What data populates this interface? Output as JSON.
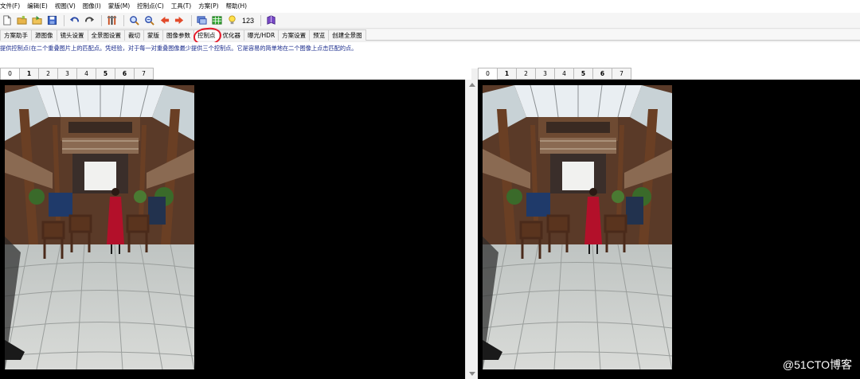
{
  "menu": [
    "文件(F)",
    "编辑(E)",
    "视图(V)",
    "图像(I)",
    "蒙版(M)",
    "控制点(C)",
    "工具(T)",
    "方案(P)",
    "帮助(H)"
  ],
  "toolbar": {
    "icons": [
      "new-project-icon",
      "open-icon",
      "open-images-icon",
      "save-icon",
      "undo-icon",
      "redo-icon",
      "optimize-icon",
      "zoom-in-icon",
      "zoom-out-icon",
      "prev-icon",
      "next-icon",
      "preview-icon",
      "grid-icon",
      "hint-icon",
      "show-numbers-icon",
      "book-icon"
    ],
    "number_label": "123"
  },
  "tabs": [
    "方案助手",
    "源图像",
    "镜头设置",
    "全景图设置",
    "裁切",
    "蒙版",
    "图像参数",
    "控制点",
    "优化器",
    "曝光/HDR",
    "方案设置",
    "预览",
    "创建全景图"
  ],
  "active_tab": "控制点",
  "hint_text": "提供控制点(在二个重叠图片上的匹配点。凭经验，对于每一对重叠图像最少提供三个控制点。它是容易的简单地在二个图像上点击匹配的点。",
  "left_panel": {
    "image_tabs": [
      "0",
      "1",
      "2",
      "3",
      "4",
      "5",
      "6",
      "7"
    ],
    "active": "0"
  },
  "right_panel": {
    "image_tabs": [
      "0",
      "1",
      "2",
      "3",
      "4",
      "5",
      "6",
      "7"
    ],
    "active": "0"
  },
  "watermark": "@51CTO博客",
  "colors": {
    "accent_circle": "#e51a2a",
    "hint_text": "#1a2b8c",
    "canvas": "#000000"
  }
}
